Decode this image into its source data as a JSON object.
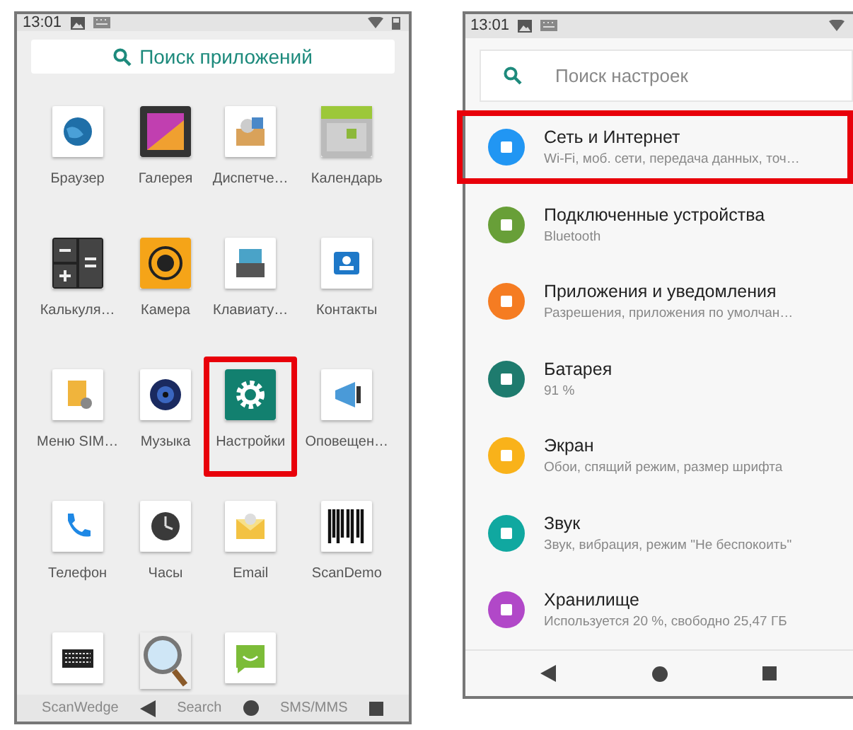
{
  "launcher": {
    "status_bar": {
      "time": "13:01"
    },
    "search": {
      "placeholder": "Поиск приложений"
    },
    "apps": [
      {
        "label": "Браузер",
        "highlighted": false
      },
      {
        "label": "Галерея",
        "highlighted": false
      },
      {
        "label": "Диспетче…",
        "highlighted": false
      },
      {
        "label": "Календарь",
        "highlighted": false
      },
      {
        "label": "Калькуля…",
        "highlighted": false
      },
      {
        "label": "Камера",
        "highlighted": false
      },
      {
        "label": "Клавиату…",
        "highlighted": false
      },
      {
        "label": "Контакты",
        "highlighted": false
      },
      {
        "label": "Меню SIM…",
        "highlighted": false
      },
      {
        "label": "Музыка",
        "highlighted": false
      },
      {
        "label": "Настройки",
        "highlighted": true
      },
      {
        "label": "Оповещен…",
        "highlighted": false
      },
      {
        "label": "Телефон",
        "highlighted": false
      },
      {
        "label": "Часы",
        "highlighted": false
      },
      {
        "label": "Email",
        "highlighted": false
      },
      {
        "label": "ScanDemo",
        "highlighted": false
      },
      {
        "label": "ScanWedge",
        "highlighted": false
      },
      {
        "label": "Search",
        "highlighted": false
      },
      {
        "label": "SMS/MMS",
        "highlighted": false
      }
    ]
  },
  "settings": {
    "status_bar": {
      "time": "13:01"
    },
    "search": {
      "placeholder": "Поиск настроек"
    },
    "items": [
      {
        "title": "Сеть и Интернет",
        "subtitle": "Wi-Fi, моб. сети, передача данных, точ…",
        "color": "#2196f3",
        "highlighted": true
      },
      {
        "title": "Подключенные устройства",
        "subtitle": "Bluetooth",
        "color": "#689f38",
        "highlighted": false
      },
      {
        "title": "Приложения и уведомления",
        "subtitle": "Разрешения, приложения по умолчан…",
        "color": "#f57c22",
        "highlighted": false
      },
      {
        "title": "Батарея",
        "subtitle": "91 %",
        "color": "#1e7b6e",
        "highlighted": false
      },
      {
        "title": "Экран",
        "subtitle": "Обои, спящий режим, размер шрифта",
        "color": "#f9b21a",
        "highlighted": false
      },
      {
        "title": "Звук",
        "subtitle": "Звук, вибрация, режим \"Не беспокоить\"",
        "color": "#10a8a0",
        "highlighted": false
      },
      {
        "title": "Хранилище",
        "subtitle": "Используется 20 %, свободно 25,47 ГБ",
        "color": "#b148c8",
        "highlighted": false
      }
    ]
  }
}
